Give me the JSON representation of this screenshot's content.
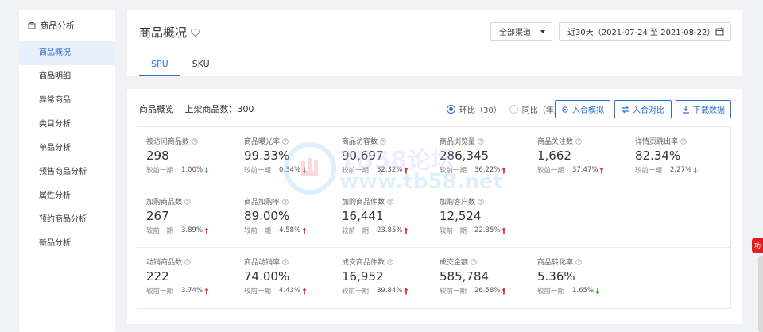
{
  "sidebar": {
    "header": "商品分析",
    "items": [
      {
        "label": "商品概况",
        "active": true
      },
      {
        "label": "商品明细"
      },
      {
        "label": "异常商品"
      },
      {
        "label": "类目分析"
      },
      {
        "label": "单品分析"
      },
      {
        "label": "预售商品分析"
      },
      {
        "label": "属性分析"
      },
      {
        "label": "预约商品分析"
      },
      {
        "label": "新品分析"
      }
    ]
  },
  "header": {
    "title": "商品概况",
    "channel": "全部渠道",
    "date_range": "近30天（2021-07-24 至 2021-08-22）",
    "tabs": [
      {
        "label": "SPU",
        "active": true
      },
      {
        "label": "SKU"
      }
    ]
  },
  "overview": {
    "title": "商品概览",
    "listed_count": "上架商品数：300",
    "radio": [
      {
        "label": "环比（30）",
        "checked": true
      },
      {
        "label": "同比（年）",
        "checked": false
      }
    ],
    "buttons": {
      "compare_model": "入合模拟",
      "compare": "入合对比",
      "download": "下载数据"
    }
  },
  "compare_label": "较前一期",
  "metrics": [
    [
      {
        "label": "被访问商品数",
        "value": "298",
        "pct": "1.00%",
        "trend": "down"
      },
      {
        "label": "商品曝光率",
        "value": "99.33%",
        "pct": "0.34%",
        "trend": "down"
      },
      {
        "label": "商品访客数",
        "value": "90,697",
        "pct": "32.32%",
        "trend": "up"
      },
      {
        "label": "商品浏览量",
        "value": "286,345",
        "pct": "36.22%",
        "trend": "up"
      },
      {
        "label": "商品关注数",
        "value": "1,662",
        "pct": "37.47%",
        "trend": "up"
      },
      {
        "label": "详情页跳出率",
        "value": "82.34%",
        "pct": "2.27%",
        "trend": "down"
      }
    ],
    [
      {
        "label": "加购商品数",
        "value": "267",
        "pct": "3.89%",
        "trend": "up"
      },
      {
        "label": "商品加购率",
        "value": "89.00%",
        "pct": "4.58%",
        "trend": "up"
      },
      {
        "label": "加购商品件数",
        "value": "16,441",
        "pct": "23.85%",
        "trend": "up"
      },
      {
        "label": "加购客户数",
        "value": "12,524",
        "pct": "22.35%",
        "trend": "up"
      }
    ],
    [
      {
        "label": "动销商品数",
        "value": "222",
        "pct": "3.74%",
        "trend": "up"
      },
      {
        "label": "商品动销率",
        "value": "74.00%",
        "pct": "4.43%",
        "trend": "up"
      },
      {
        "label": "成交商品件数",
        "value": "16,952",
        "pct": "39.84%",
        "trend": "up"
      },
      {
        "label": "成交金额",
        "value": "585,784",
        "pct": "26.58%",
        "trend": "up"
      },
      {
        "label": "商品转化率",
        "value": "5.36%",
        "pct": "1.65%",
        "trend": "down"
      }
    ]
  ],
  "watermark": {
    "line1": "TB58论坛",
    "line2": "www.tb58.net"
  },
  "edge_badge": "功",
  "colors": {
    "accent": "#2f6fd6",
    "up": "#e02020",
    "down": "#2aa52a"
  }
}
